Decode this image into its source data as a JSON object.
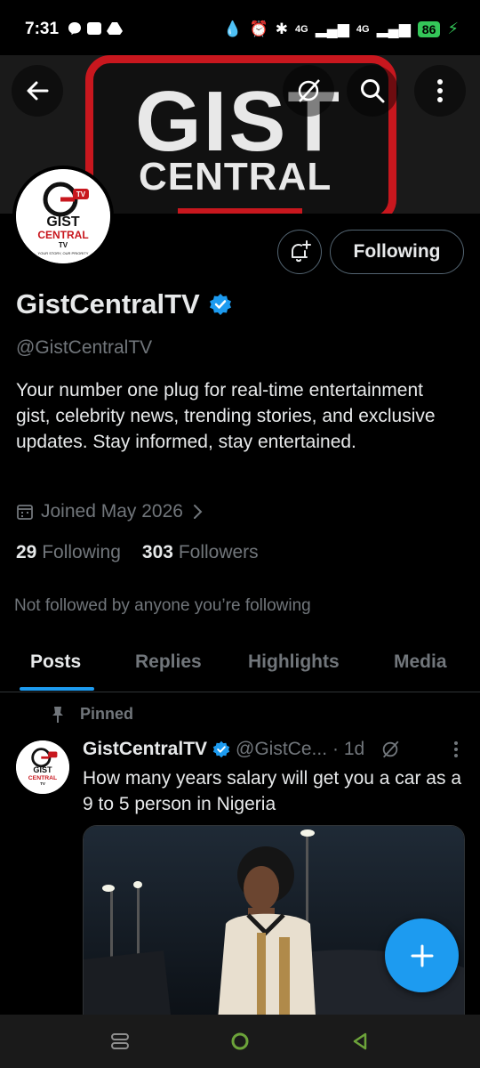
{
  "status_bar": {
    "time": "7:31",
    "battery": "86",
    "network_1": "4G",
    "network_2": "4G"
  },
  "banner": {
    "line1": "GIST",
    "line2": "CENTRAL",
    "brand_color": "#c8171e"
  },
  "header_icons": [
    "back-arrow-icon",
    "grok-icon",
    "search-icon",
    "more-vertical-icon"
  ],
  "avatar_logo": {
    "line1": "GIST",
    "line2": "CENTRAL",
    "line3": "TV",
    "tagline": "YOUR STORY, OUR PRIORITY",
    "badge": "TV"
  },
  "profile": {
    "display_name": "GistCentralTV",
    "handle": "@GistCentralTV",
    "bio": "Your number one plug for real-time entertainment gist, celebrity news, trending stories, and exclusive updates. Stay informed, stay entertained.",
    "joined": "Joined May 2026",
    "following_count": "29",
    "following_label": "Following",
    "followers_count": "303",
    "followers_label": "Followers",
    "not_followed_text": "Not followed by anyone you’re following",
    "follow_button_label": "Following"
  },
  "tabs": [
    {
      "label": "Posts",
      "active": true
    },
    {
      "label": "Replies",
      "active": false
    },
    {
      "label": "Highlights",
      "active": false
    },
    {
      "label": "Media",
      "active": false
    }
  ],
  "post": {
    "pinned_label": "Pinned",
    "author": "GistCentralTV",
    "handle": "@GistCe...",
    "time": "· 1d",
    "text": "How many years salary will get you a car as a 9 to 5 person in Nigeria"
  },
  "colors": {
    "accent": "#1d9bf0",
    "background": "#000000",
    "muted_text": "#71767b",
    "primary_text": "#e7e9ea",
    "verified": "#1d9bf0"
  }
}
